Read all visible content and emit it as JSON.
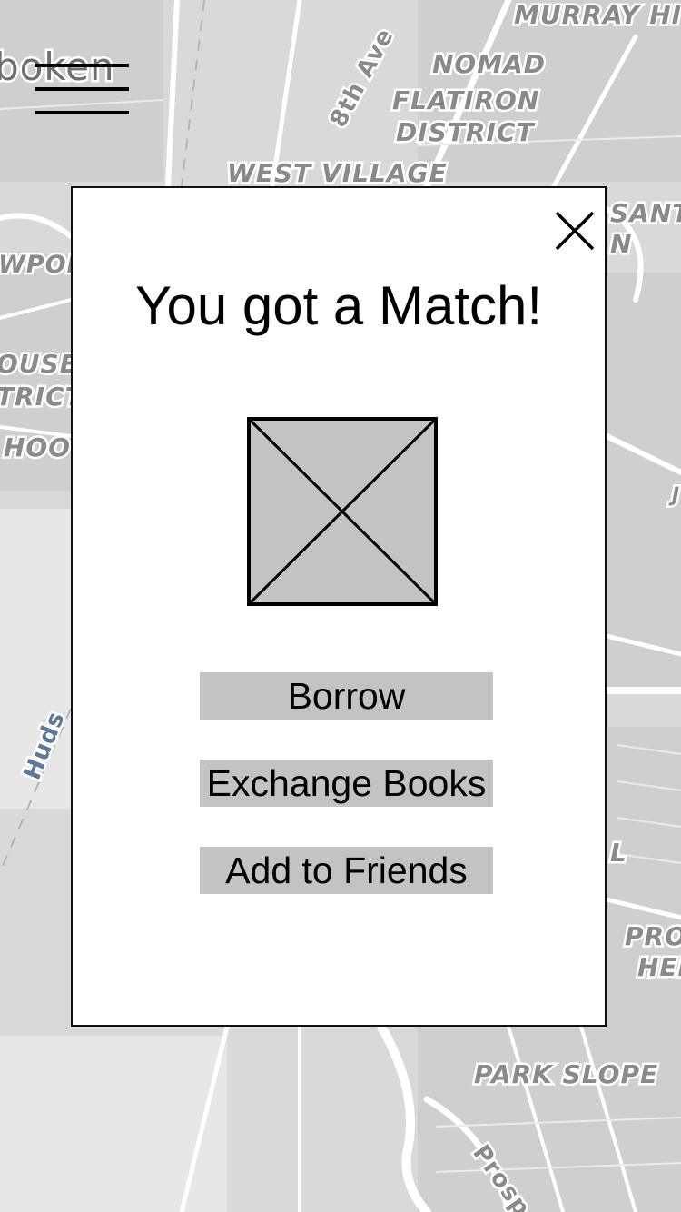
{
  "map": {
    "labels": {
      "hoboken": "boken",
      "murray_hill": "MURRAY HI",
      "nomad": "NOMAD",
      "flatiron_1": "FLATIRON",
      "flatiron_2": "DISTRICT",
      "eighth_ave": "8th Ave",
      "west_village": "WEST VILLAGE",
      "newport": "WPOR",
      "house_1": "OUSE",
      "house_2": "TRICT",
      "hood": "HOO",
      "sant_1": "SANT",
      "sant_2": "N",
      "hudson": "Huds",
      "pro_1": "PRO",
      "pro_2": "HEI",
      "park_slope": "PARK SLOPE",
      "prospect": "Prosp",
      "l_frag": "L",
      "j_frag": "J"
    }
  },
  "menu": {
    "icon": "hamburger-menu-icon"
  },
  "modal": {
    "title": "You got a Match!",
    "close_icon": "close-icon",
    "image_icon": "image-placeholder-icon",
    "buttons": {
      "borrow": "Borrow",
      "exchange": "Exchange Books",
      "add_friends": "Add to Friends"
    }
  },
  "colors": {
    "map_background": "#d9d9d9",
    "modal_background": "#ffffff",
    "button_fill": "#c3c3c3",
    "image_fill": "#c3c3c3"
  }
}
